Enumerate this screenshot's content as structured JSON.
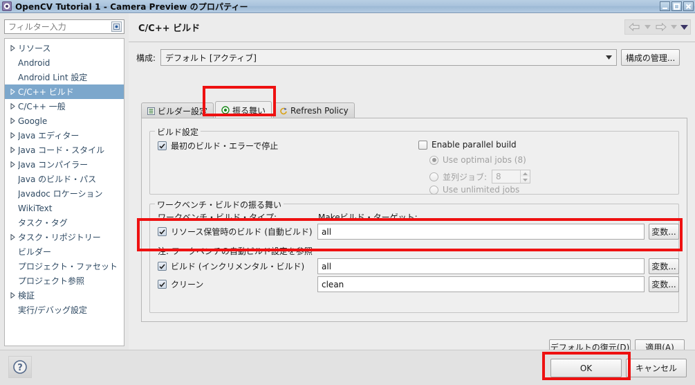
{
  "window": {
    "title": "OpenCV Tutorial 1 - Camera Preview のプロパティー",
    "icon": "gear-icon",
    "minimize": "minimize-icon",
    "maximize": "maximize-icon",
    "close": "close-icon"
  },
  "sidebar": {
    "filter": {
      "placeholder": "フィルター入力",
      "value": "",
      "icon": "filter-clear-icon"
    },
    "items": [
      {
        "label": "リソース",
        "expandable": true,
        "selected": false
      },
      {
        "label": "Android",
        "expandable": false,
        "selected": false
      },
      {
        "label": "Android Lint 設定",
        "expandable": false,
        "selected": false
      },
      {
        "label": "C/C++ ビルド",
        "expandable": true,
        "selected": true
      },
      {
        "label": "C/C++ 一般",
        "expandable": true,
        "selected": false
      },
      {
        "label": "Google",
        "expandable": true,
        "selected": false
      },
      {
        "label": "Java エディター",
        "expandable": true,
        "selected": false
      },
      {
        "label": "Java コード・スタイル",
        "expandable": true,
        "selected": false
      },
      {
        "label": "Java コンパイラー",
        "expandable": true,
        "selected": false
      },
      {
        "label": "Java のビルド・パス",
        "expandable": false,
        "selected": false
      },
      {
        "label": "Javadoc ロケーション",
        "expandable": false,
        "selected": false
      },
      {
        "label": "WikiText",
        "expandable": false,
        "selected": false
      },
      {
        "label": "タスク・タグ",
        "expandable": false,
        "selected": false
      },
      {
        "label": "タスク・リポジトリー",
        "expandable": true,
        "selected": false
      },
      {
        "label": "ビルダー",
        "expandable": false,
        "selected": false
      },
      {
        "label": "プロジェクト・ファセット",
        "expandable": false,
        "selected": false
      },
      {
        "label": "プロジェクト参照",
        "expandable": false,
        "selected": false
      },
      {
        "label": "検証",
        "expandable": true,
        "selected": false
      },
      {
        "label": "実行/デバッグ設定",
        "expandable": false,
        "selected": false
      }
    ]
  },
  "page": {
    "title": "C/C++ ビルド",
    "nav": {
      "back_icon": "back-arrow-icon",
      "back_caret_icon": "chevron-down-icon",
      "forward_icon": "forward-arrow-icon",
      "forward_caret_icon": "chevron-down-icon",
      "menu_icon": "chevron-down-icon"
    }
  },
  "config": {
    "label": "構成:",
    "value": "デフォルト [アクティブ]",
    "dropdown_icon": "chevron-down-icon",
    "manage_button": "構成の管理..."
  },
  "tabs": [
    {
      "label": "ビルダー設定",
      "icon": "list-icon",
      "active": false
    },
    {
      "label": "振る舞い",
      "icon": "radio-green-icon",
      "active": true
    },
    {
      "label": "Refresh Policy",
      "icon": "refresh-key-icon",
      "active": false
    }
  ],
  "build_settings": {
    "group_title": "ビルド設定",
    "stop_on_error": {
      "label": "最初のビルド・エラーで停止",
      "checked": true
    },
    "enable_parallel": {
      "label": "Enable parallel build",
      "checked": false
    },
    "optimal_jobs": {
      "label": "Use optimal jobs (8)",
      "selected": true,
      "disabled": true
    },
    "parallel_jobs": {
      "label": "並列ジョブ:",
      "selected": false,
      "disabled": true,
      "value": "8"
    },
    "unlimited_jobs": {
      "label": "Use unlimited jobs",
      "selected": false,
      "disabled": true
    }
  },
  "workbench": {
    "group_title": "ワークベンチ・ビルドの振る舞い",
    "col_type_label": "ワークベンチ・ビルド・タイプ:",
    "col_target_label": "Makeビルド・ターゲット:",
    "note": "注: ワークベンチの自動ビルド設定を参照",
    "rows": [
      {
        "label": "リソース保管時のビルド (自動ビルド)",
        "checked": true,
        "value": "all",
        "button": "変数..."
      },
      {
        "label": "ビルド (インクリメンタル・ビルド)",
        "checked": true,
        "value": "all",
        "button": "変数..."
      },
      {
        "label": "クリーン",
        "checked": true,
        "value": "clean",
        "button": "変数..."
      }
    ]
  },
  "actions": {
    "restore_defaults": "デフォルトの復元(D)",
    "apply": "適用(A)",
    "help_icon": "help-icon",
    "ok": "OK",
    "cancel": "キャンセル"
  },
  "annotations": {
    "highlight_color": "#ee1111",
    "boxes": [
      "behavior-tab",
      "build-on-resource-save-row",
      "ok-button"
    ]
  }
}
